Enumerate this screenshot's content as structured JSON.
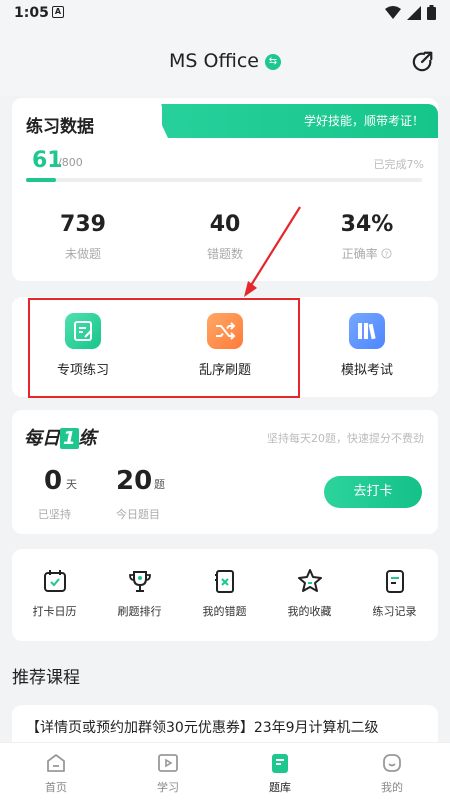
{
  "status_bar": {
    "time": "1:05",
    "sim_icon": "A"
  },
  "header": {
    "title": "MS Office",
    "badge": "⇆"
  },
  "practice_data": {
    "title": "练习数据",
    "slogan": "学好技能，顺带考证！",
    "done_count": "61",
    "total": "/800",
    "completed_text": "已完成7%",
    "progress_fraction": 0.076,
    "stats": [
      {
        "value": "739",
        "label": "未做题"
      },
      {
        "value": "40",
        "label": "错题数"
      },
      {
        "value": "34%",
        "label": "正确率"
      }
    ]
  },
  "modes": [
    {
      "label": "专项练习",
      "icon": "edit-note-icon"
    },
    {
      "label": "乱序刷题",
      "icon": "shuffle-icon"
    },
    {
      "label": "模拟考试",
      "icon": "books-icon"
    }
  ],
  "daily": {
    "logo_pre": "每日",
    "logo_one": "1",
    "logo_post": "练",
    "tip": "坚持每天20题，快速提分不费劲",
    "streak_value": "0",
    "streak_unit": "天",
    "streak_label": "已坚持",
    "today_value": "20",
    "today_unit": "题",
    "today_label": "今日题目",
    "button": "去打卡"
  },
  "tools": [
    {
      "label": "打卡日历",
      "icon": "calendar-check-icon"
    },
    {
      "label": "刷题排行",
      "icon": "trophy-icon"
    },
    {
      "label": "我的错题",
      "icon": "wrong-book-icon"
    },
    {
      "label": "我的收藏",
      "icon": "star-icon"
    },
    {
      "label": "练习记录",
      "icon": "record-icon"
    }
  ],
  "recommend": {
    "title": "推荐课程",
    "course_text": "【详情页或预约加群领30元优惠券】23年9月计算机二级"
  },
  "tabbar": [
    {
      "label": "首页",
      "icon": "home-icon"
    },
    {
      "label": "学习",
      "icon": "study-icon"
    },
    {
      "label": "题库",
      "icon": "question-bank-icon"
    },
    {
      "label": "我的",
      "icon": "profile-icon"
    }
  ],
  "colors": {
    "accent": "#1ec78e",
    "highlight_red": "#e5262b"
  }
}
